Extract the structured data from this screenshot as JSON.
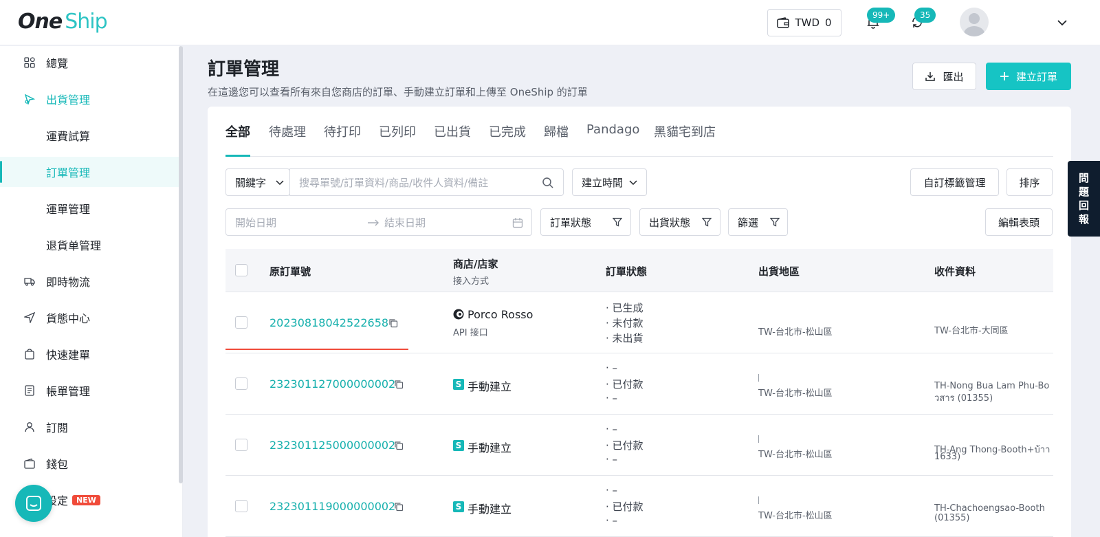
{
  "header": {
    "logo_one": "One",
    "logo_ship": "Ship",
    "currency": "TWD",
    "balance": "0",
    "notifications_badge": "99+",
    "updates_badge": "35"
  },
  "sidebar": {
    "items": [
      {
        "label": "總覽",
        "icon": "dashboard-icon"
      },
      {
        "label": "出貨管理",
        "icon": "shipping-icon"
      },
      {
        "label": "運費試算"
      },
      {
        "label": "訂單管理"
      },
      {
        "label": "運單管理"
      },
      {
        "label": "退貨单管理"
      },
      {
        "label": "即時物流",
        "icon": "delivery-icon"
      },
      {
        "label": "貨態中心",
        "icon": "navigation-icon"
      },
      {
        "label": "快速建單",
        "icon": "bag-icon"
      },
      {
        "label": "帳單管理",
        "icon": "bill-icon"
      },
      {
        "label": "訂閱",
        "icon": "user-icon"
      },
      {
        "label": "錢包",
        "icon": "wallet-icon"
      },
      {
        "label": "設定",
        "icon": "settings-icon",
        "badge": "NEW"
      }
    ]
  },
  "main": {
    "title": "訂單管理",
    "subtitle": "在這邊您可以查看所有來自您商店的訂單、手動建立訂單和上傳至 OneShip 的訂單",
    "export_label": "匯出",
    "create_label": "建立訂單",
    "tabs": [
      "全部",
      "待處理",
      "待打印",
      "已列印",
      "已出貨",
      "已完成",
      "歸檔",
      "Pandago",
      "黑貓宅到店"
    ],
    "filters": {
      "keyword_select": "關鍵字",
      "search_placeholder": "搜尋單號/訂單資料/商品/收件人資料/備註",
      "time_select": "建立時間",
      "custom_tags": "自訂標籤管理",
      "sort": "排序",
      "start_date": "開始日期",
      "end_date": "結束日期",
      "order_status": "訂單狀態",
      "shipping_status": "出貨狀態",
      "filter": "篩選",
      "edit_columns": "編輯表頭"
    },
    "table": {
      "headers": {
        "order_no": "原訂單號",
        "shop": "商店/店家",
        "shop_sub": "接入方式",
        "status": "訂單狀態",
        "region": "出貨地區",
        "receiver": "收件資料"
      },
      "rows": [
        {
          "order_no": "20230818042522658",
          "shop": "Porco Rosso",
          "shop_sub": "API 接口",
          "status": [
            "· 已生成",
            "· 未付款",
            "· 未出貨"
          ],
          "region": "TW-台北市-松山區",
          "receiver": "TW-台北市-大同區",
          "receiver2": ""
        },
        {
          "order_no": "232301127000000002",
          "shop": "手動建立",
          "status": [
            "· –",
            "· 已付款",
            "· –"
          ],
          "region": "TW-台北市-松山區",
          "receiver": "TH-Nong Bua Lam Phu-Bo",
          "receiver2": "วสาร (01355)"
        },
        {
          "order_no": "232301125000000002",
          "shop": "手動建立",
          "status": [
            "· –",
            "· 已付款",
            "· –"
          ],
          "region": "TW-台北市-松山區",
          "receiver": "TH-Ang Thong-Booth+บ้าา",
          "receiver2": "1633)"
        },
        {
          "order_no": "232301119000000002",
          "shop": "手動建立",
          "status": [
            "· –",
            "· 已付款",
            "· –"
          ],
          "region": "TW-台北市-松山區",
          "receiver": "TH-Chachoengsao-Booth",
          "receiver2": "(01355)"
        }
      ]
    },
    "feedback_tab": [
      "問",
      "題",
      "回",
      "報"
    ]
  },
  "colors": {
    "accent": "#16b8b8",
    "danger": "#f04b3a",
    "dark_tab": "#0f1d2e"
  }
}
